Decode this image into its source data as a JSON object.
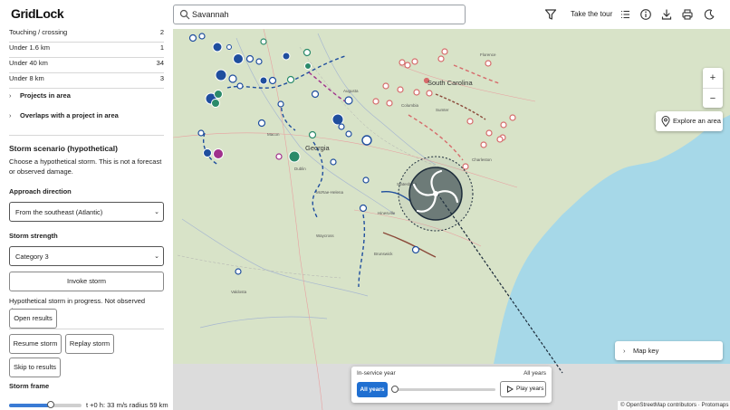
{
  "app": {
    "name": "GridLock"
  },
  "search": {
    "value": "Savannah",
    "placeholder": ""
  },
  "header": {
    "tour_label": "Take the tour"
  },
  "proximity_rows": [
    {
      "label": "Touching / crossing",
      "value": "2"
    },
    {
      "label": "Under 1.6 km",
      "value": "1"
    },
    {
      "label": "Under 40 km",
      "value": "34"
    },
    {
      "label": "Under 8 km",
      "value": "3"
    }
  ],
  "sections": {
    "projects_in_area": "Projects in area",
    "overlaps": "Overlaps with a project in area"
  },
  "storm": {
    "title": "Storm scenario (hypothetical)",
    "description": "Choose a hypothetical storm. This is not a forecast or observed damage.",
    "approach_label": "Approach direction",
    "approach_value": "From the southeast (Atlantic)",
    "strength_label": "Storm strength",
    "strength_value": "Category 3",
    "invoke_label": "Invoke storm",
    "status": "Hypothetical storm in progress. Not observed damage.",
    "open_results_label": "Open results",
    "resume_label": "Resume storm",
    "replay_label": "Replay storm",
    "skip_label": "Skip to results",
    "frame_label": "Storm frame",
    "frame_value": "t +0 h: 33 m/s radius 59 km",
    "frame_progress": 0.57
  },
  "map": {
    "labels": {
      "south_carolina": "South Carolina",
      "georgia": "Georgia",
      "towns": [
        "Florence",
        "Columbia",
        "Sumter",
        "Charleston",
        "Augusta",
        "Statesboro",
        "Hinesville",
        "Brunswick",
        "Waycross",
        "McRae-Helena",
        "Macon",
        "Dublin",
        "Valdosta"
      ]
    },
    "explore_label": "Explore an area",
    "zoom_in": "+",
    "zoom_out": "−",
    "map_key_label": "Map key",
    "attribution": "© OpenStreetMap contributors · Protomaps",
    "colors": {
      "land": "#d8e3c8",
      "water": "#a6d8e8",
      "project_ring": "#1f4e9e",
      "planned_ring": "#d66b6b",
      "storm": "#1c2b3a"
    }
  },
  "timeline": {
    "title": "In-service year",
    "current": "All years",
    "all_years_label": "All years",
    "play_label": "Play years"
  },
  "icons": {
    "search": "search-icon",
    "filter": "filter-icon",
    "list": "list-icon",
    "info": "info-icon",
    "download": "download-icon",
    "print": "print-icon",
    "theme": "moon-icon",
    "pin": "map-pin-icon",
    "play": "play-icon",
    "chevron": "chevron-right-icon"
  }
}
